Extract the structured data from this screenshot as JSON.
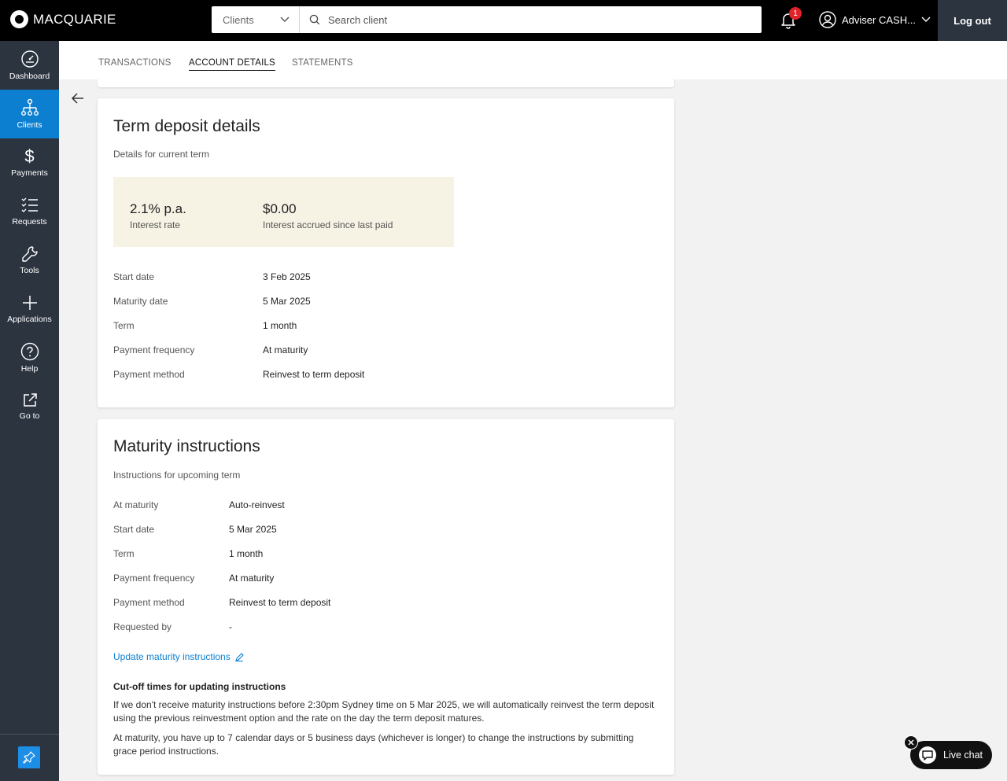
{
  "header": {
    "brand": "MACQUARIE",
    "search_select": "Clients",
    "search_placeholder": "Search client",
    "notification_count": "1",
    "user_name": "Adviser CASH...",
    "logout_label": "Log out"
  },
  "sidebar": {
    "items": [
      {
        "label": "Dashboard",
        "icon": "gauge-icon"
      },
      {
        "label": "Clients",
        "icon": "org-chart-icon"
      },
      {
        "label": "Payments",
        "icon": "dollar-icon"
      },
      {
        "label": "Requests",
        "icon": "checklist-icon"
      },
      {
        "label": "Tools",
        "icon": "wrench-icon"
      },
      {
        "label": "Applications",
        "icon": "plus-icon"
      },
      {
        "label": "Help",
        "icon": "question-icon"
      },
      {
        "label": "Go to",
        "icon": "external-link-icon"
      }
    ],
    "active": "Clients"
  },
  "tabs": [
    {
      "label": "TRANSACTIONS"
    },
    {
      "label": "ACCOUNT DETAILS"
    },
    {
      "label": "STATEMENTS"
    }
  ],
  "term_deposit": {
    "title": "Term deposit details",
    "subtitle": "Details for current term",
    "interest_rate_value": "2.1% p.a.",
    "interest_rate_label": "Interest rate",
    "accrued_value": "$0.00",
    "accrued_label": "Interest accrued since last paid",
    "rows": [
      {
        "label": "Start date",
        "value": "3 Feb 2025"
      },
      {
        "label": "Maturity date",
        "value": "5 Mar 2025"
      },
      {
        "label": "Term",
        "value": "1 month"
      },
      {
        "label": "Payment frequency",
        "value": "At maturity"
      },
      {
        "label": "Payment method",
        "value": "Reinvest to term deposit"
      }
    ]
  },
  "maturity": {
    "title": "Maturity instructions",
    "subtitle": "Instructions for upcoming term",
    "rows": [
      {
        "label": "At maturity",
        "value": "Auto-reinvest"
      },
      {
        "label": "Start date",
        "value": "5 Mar 2025"
      },
      {
        "label": "Term",
        "value": "1 month"
      },
      {
        "label": "Payment frequency",
        "value": "At maturity"
      },
      {
        "label": "Payment method",
        "value": "Reinvest to term deposit"
      },
      {
        "label": "Requested by",
        "value": "-"
      }
    ],
    "update_link": "Update maturity instructions",
    "cutoff_title": "Cut-off times for updating instructions",
    "cutoff_para1": "If we don't receive maturity instructions before 2:30pm Sydney time on 5 Mar 2025, we will automatically reinvest the term deposit using the previous reinvestment option and the rate on the day the term deposit matures.",
    "cutoff_para2": "At maturity, you have up to 7 calendar days or 5 business days (whichever is longer) to change the instructions by submitting grace period instructions."
  },
  "live_chat": {
    "label": "Live chat"
  },
  "colors": {
    "accent": "#0c7fd1",
    "sidebar": "#2c3440",
    "highlight": "#f6f2e4",
    "badge": "#e0232a"
  }
}
